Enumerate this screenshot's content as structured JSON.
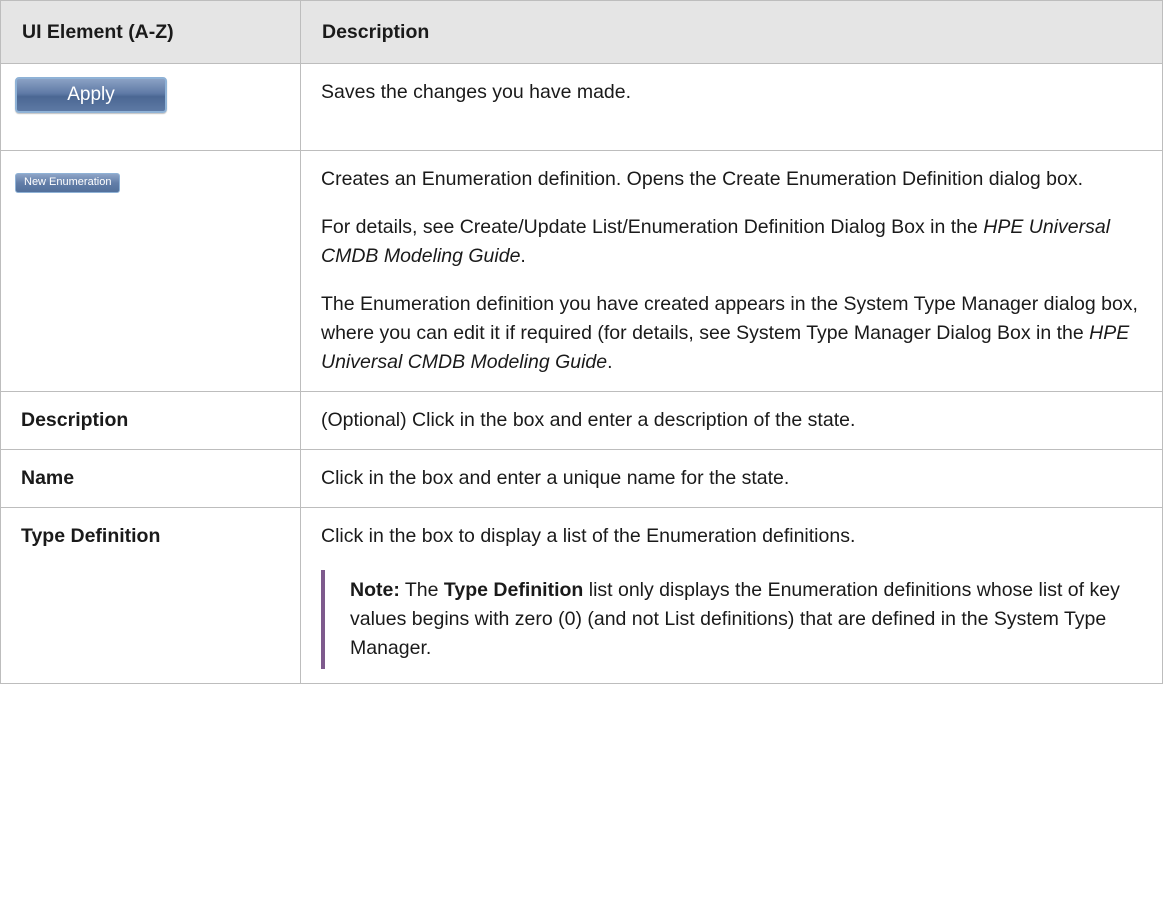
{
  "table": {
    "header": {
      "col1": "UI Element (A-Z)",
      "col2": "Description"
    },
    "apply": {
      "button_label": "Apply",
      "description": "Saves the changes you have made."
    },
    "new_enumeration": {
      "button_label": "New Enumeration",
      "p1": "Creates an Enumeration definition. Opens the Create Enumeration Definition dialog box.",
      "p2_a": "For details, see Create/Update List/Enumeration Definition Dialog Box in the ",
      "p2_em": "HPE Universal CMDB Modeling Guide",
      "p2_b": ".",
      "p3_a": "The Enumeration definition you have created appears in the System Type Manager dialog box, where you can edit it if required (for details, see System Type Manager Dialog Box in the ",
      "p3_em": "HPE Universal CMDB Modeling Guide",
      "p3_b": "."
    },
    "description_row": {
      "name": "Description",
      "text": "(Optional) Click in the box and enter a description of the state."
    },
    "name_row": {
      "name": "Name",
      "text": "Click in the box and enter a unique name for the state."
    },
    "type_definition_row": {
      "name": "Type Definition",
      "text": "Click in the box to display a list of the Enumeration definitions.",
      "note_label": "Note:",
      "note_a": " The ",
      "note_strong": "Type Definition",
      "note_b": " list only displays the Enumeration definitions whose list of key values begins with zero (0) (and not List definitions) that are defined in the System Type Manager."
    }
  }
}
